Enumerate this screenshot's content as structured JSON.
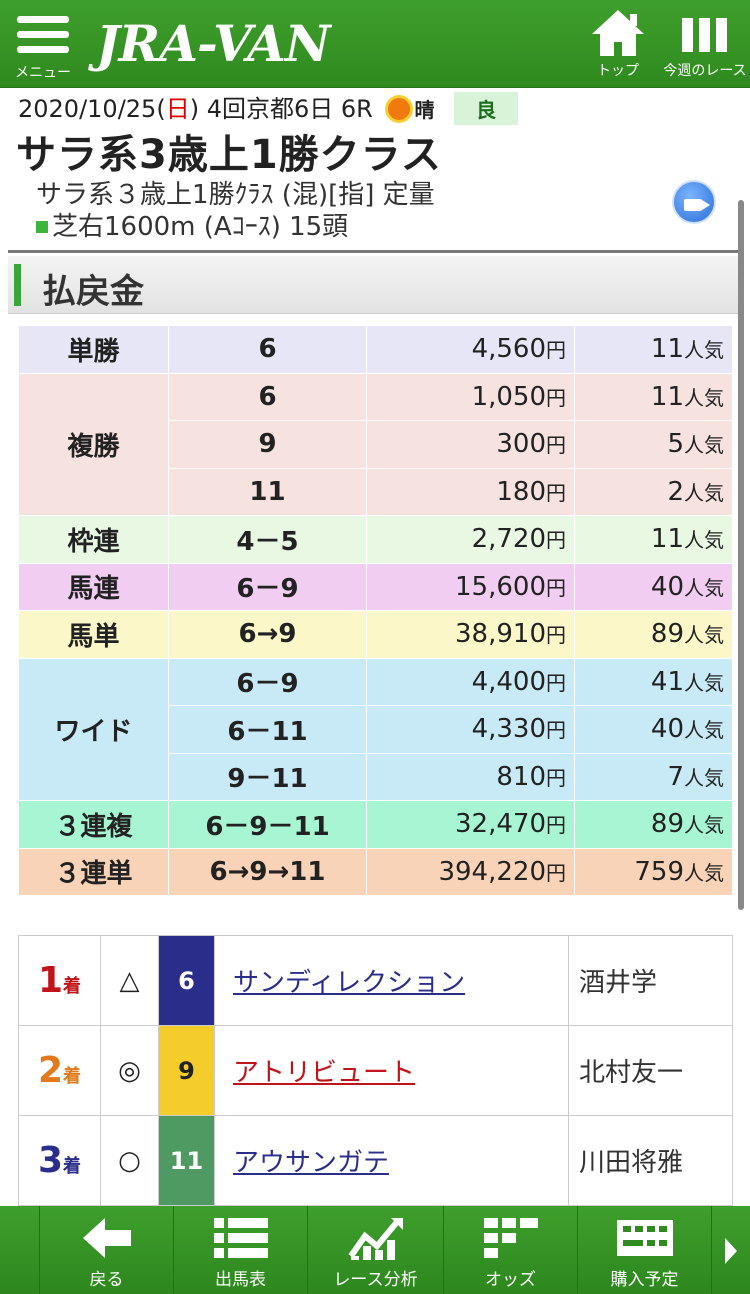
{
  "header": {
    "logo": "JRA-VAN",
    "menu_label": "メニュー",
    "top_label": "トップ",
    "week_label": "今週のレース"
  },
  "race": {
    "date_prefix": "2020/10/25(",
    "weekday": "日",
    "date_suffix": ") 4回京都6日 6R",
    "weather": "晴",
    "going": "良",
    "title": "サラ系3歳上1勝クラス",
    "subtitle": "サラ系３歳上1勝ｸﾗｽ (混)[指] 定量",
    "course": "芝右1600m (Aｺｰｽ) 15頭"
  },
  "section": {
    "title": "払戻金"
  },
  "payout": {
    "yen_unit": "円",
    "pop_unit": "人気",
    "tansho": {
      "label": "単勝",
      "rows": [
        {
          "comb": "6",
          "amount": "4,560",
          "pop": "11"
        }
      ]
    },
    "fukusho": {
      "label": "複勝",
      "rows": [
        {
          "comb": "6",
          "amount": "1,050",
          "pop": "11"
        },
        {
          "comb": "9",
          "amount": "300",
          "pop": "5"
        },
        {
          "comb": "11",
          "amount": "180",
          "pop": "2"
        }
      ]
    },
    "wakuren": {
      "label": "枠連",
      "rows": [
        {
          "comb": "4－5",
          "amount": "2,720",
          "pop": "11"
        }
      ]
    },
    "umaren": {
      "label": "馬連",
      "rows": [
        {
          "comb": "6－9",
          "amount": "15,600",
          "pop": "40"
        }
      ]
    },
    "umatan": {
      "label": "馬単",
      "rows": [
        {
          "comb": "6→9",
          "amount": "38,910",
          "pop": "89"
        }
      ]
    },
    "wide": {
      "label": "ワイド",
      "rows": [
        {
          "comb": "6－9",
          "amount": "4,400",
          "pop": "41"
        },
        {
          "comb": "6－11",
          "amount": "4,330",
          "pop": "40"
        },
        {
          "comb": "9－11",
          "amount": "810",
          "pop": "7"
        }
      ]
    },
    "sanrenpuku": {
      "label": "３連複",
      "rows": [
        {
          "comb": "6－9－11",
          "amount": "32,470",
          "pop": "89"
        }
      ]
    },
    "sanrentan": {
      "label": "３連単",
      "rows": [
        {
          "comb": "6→9→11",
          "amount": "394,220",
          "pop": "759"
        }
      ]
    }
  },
  "results": {
    "place_suffix": "着",
    "rows": [
      {
        "place": "1",
        "mark": "△",
        "horse_no": "6",
        "name": "サンディレクション",
        "jockey": "酒井学"
      },
      {
        "place": "2",
        "mark": "◎",
        "horse_no": "9",
        "name": "アトリビュート",
        "jockey": "北村友一"
      },
      {
        "place": "3",
        "mark": "○",
        "horse_no": "11",
        "name": "アウサンガテ",
        "jockey": "川田将雅"
      }
    ]
  },
  "nav": {
    "items": [
      {
        "label": "戻る",
        "icon": "arrow-left-icon"
      },
      {
        "label": "出馬表",
        "icon": "list-icon"
      },
      {
        "label": "レース分析",
        "icon": "chart-icon"
      },
      {
        "label": "オッズ",
        "icon": "odds-grid-icon"
      },
      {
        "label": "購入予定",
        "icon": "ticket-icon"
      }
    ]
  },
  "colors": {
    "header_green": "#3f9f2c",
    "first_place": "#c0141a",
    "second_place": "#e07a1a",
    "third_place": "#2a2e8a"
  }
}
